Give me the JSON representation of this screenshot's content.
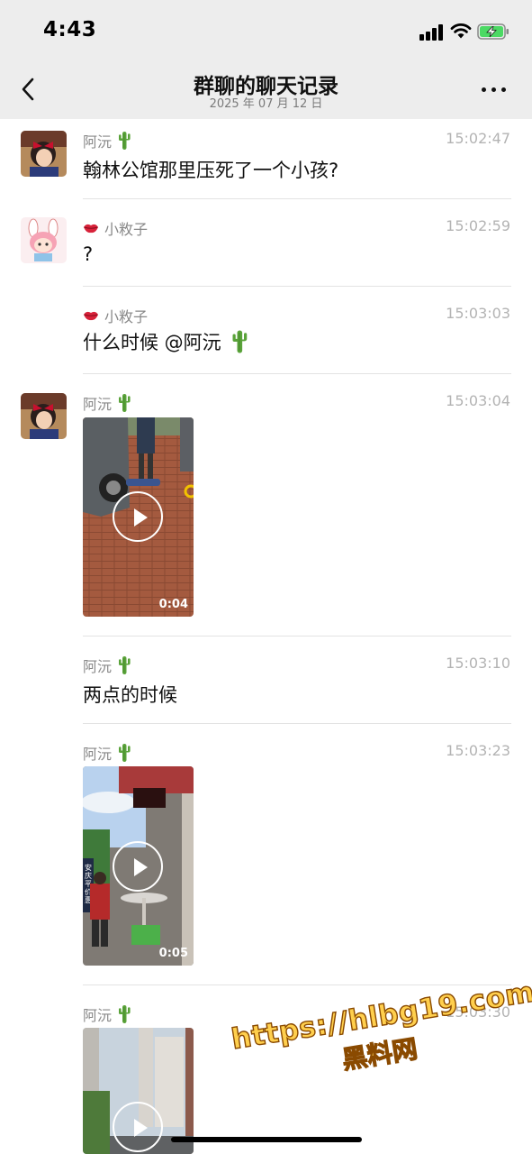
{
  "status_bar": {
    "time": "4:43"
  },
  "header": {
    "title": "群聊的聊天记录",
    "subtitle": "2025 年 07 月 12 日"
  },
  "messages": [
    {
      "sender": "阿沅",
      "time": "15:02:47",
      "text": "翰林公馆那里压死了一个小孩?"
    },
    {
      "sender": "小敉子",
      "time": "15:02:59",
      "text": "?"
    },
    {
      "sender": "小敉子",
      "time": "15:03:03",
      "text": "什么时候 @阿沅"
    },
    {
      "sender": "阿沅",
      "time": "15:03:04",
      "video_duration": "0:04"
    },
    {
      "sender": "阿沅",
      "time": "15:03:10",
      "text": "两点的时候"
    },
    {
      "sender": "阿沅",
      "time": "15:03:23",
      "video_duration": "0:05"
    },
    {
      "sender": "阿沅",
      "time": "15:03:30"
    }
  ],
  "video_overlay_text": [
    "安",
    "庆",
    "平",
    "价",
    "惠"
  ],
  "watermark": {
    "url": "https://hlbg19.com",
    "name": "黑料网"
  },
  "colors": {
    "header_bg": "#ededed",
    "divider": "#e3e3e3",
    "watermark": "#ffcf4d",
    "battery": "#4cd964"
  }
}
